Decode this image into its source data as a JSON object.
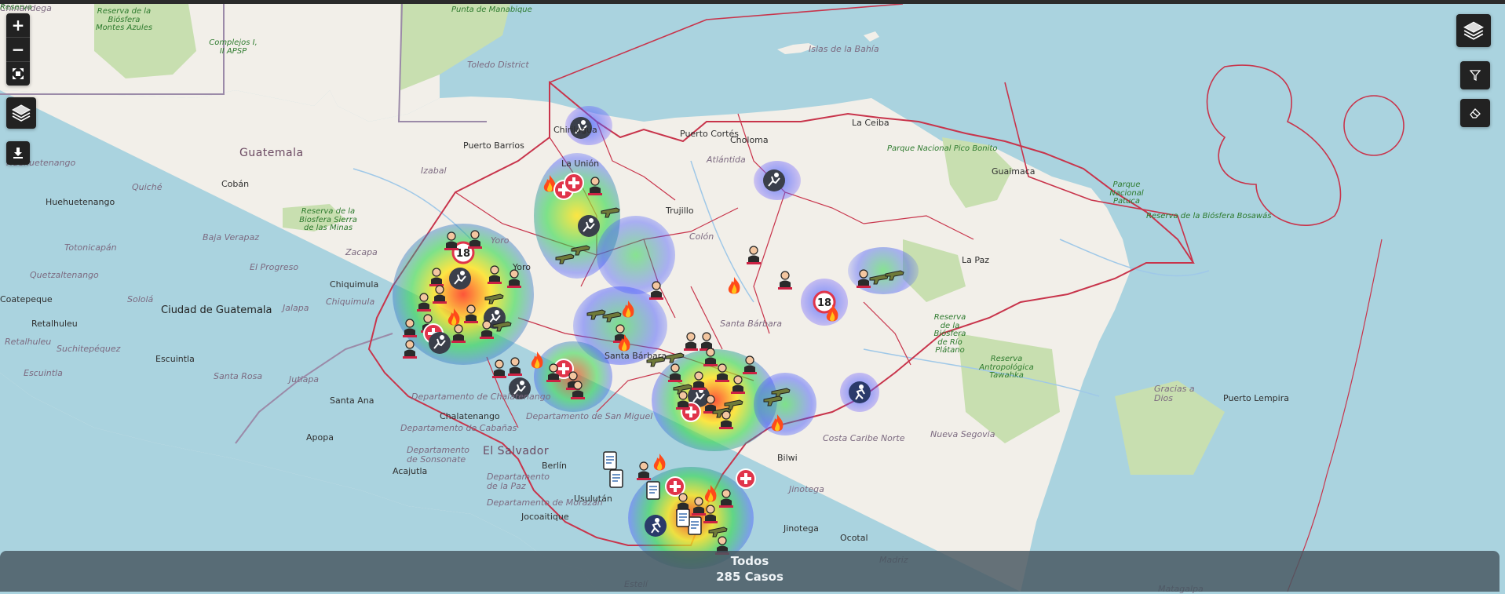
{
  "map": {
    "labels": [
      {
        "text": "Reserva de la Biósfera Montes Azules",
        "cls": "lbl-park"
      },
      {
        "text": "Complejos I, II APSP",
        "cls": "lbl-park"
      },
      {
        "text": "Punta de Manabique",
        "cls": "lbl-park"
      },
      {
        "text": "Toledo District",
        "cls": "lbl-dept"
      },
      {
        "text": "Islas de la Bahía",
        "cls": "lbl-dept"
      },
      {
        "text": "Guatemala",
        "cls": "lbl-country"
      },
      {
        "text": "Huehuetenango",
        "cls": "lbl-dept"
      },
      {
        "text": "Huehuetenango",
        "cls": "lbl-city"
      },
      {
        "text": "Cobán",
        "cls": "lbl-city"
      },
      {
        "text": "Quiché",
        "cls": "lbl-dept"
      },
      {
        "text": "Izabal",
        "cls": "lbl-dept"
      },
      {
        "text": "Puerto Barrios",
        "cls": "lbl-city"
      },
      {
        "text": "Reserva de la Biosfera Sierra de las Minas",
        "cls": "lbl-park"
      },
      {
        "text": "Baja Verapaz",
        "cls": "lbl-dept"
      },
      {
        "text": "Totonicapán",
        "cls": "lbl-dept"
      },
      {
        "text": "El Progreso",
        "cls": "lbl-dept"
      },
      {
        "text": "Zacapa",
        "cls": "lbl-dept"
      },
      {
        "text": "Quetzaltenango",
        "cls": "lbl-dept"
      },
      {
        "text": "Chiquimula",
        "cls": "lbl-city"
      },
      {
        "text": "Chiquimula",
        "cls": "lbl-dept"
      },
      {
        "text": "Coatepeque",
        "cls": "lbl-city"
      },
      {
        "text": "Sololá",
        "cls": "lbl-dept"
      },
      {
        "text": "Ciudad de Guatemala",
        "cls": "lbl-cap"
      },
      {
        "text": "Jalapa",
        "cls": "lbl-dept"
      },
      {
        "text": "Retalhuleu",
        "cls": "lbl-city"
      },
      {
        "text": "Retalhuleu",
        "cls": "lbl-dept"
      },
      {
        "text": "Suchitepéquez",
        "cls": "lbl-dept"
      },
      {
        "text": "Escuintla",
        "cls": "lbl-city"
      },
      {
        "text": "Escuintla",
        "cls": "lbl-dept"
      },
      {
        "text": "Santa Rosa",
        "cls": "lbl-dept"
      },
      {
        "text": "Jutiapa",
        "cls": "lbl-dept"
      },
      {
        "text": "Santa Ana",
        "cls": "lbl-city"
      },
      {
        "text": "Departamento de Chalatenango",
        "cls": "lbl-dept"
      },
      {
        "text": "Chalatenango",
        "cls": "lbl-city"
      },
      {
        "text": "Departamento de Cabañas",
        "cls": "lbl-dept"
      },
      {
        "text": "Apopa",
        "cls": "lbl-city"
      },
      {
        "text": "Departamento de Sonsonate",
        "cls": "lbl-dept"
      },
      {
        "text": "El Salvador",
        "cls": "lbl-country"
      },
      {
        "text": "Acajutla",
        "cls": "lbl-city"
      },
      {
        "text": "Departamento de la Paz",
        "cls": "lbl-dept"
      },
      {
        "text": "Berlín",
        "cls": "lbl-city"
      },
      {
        "text": "Departamento de San Miguel",
        "cls": "lbl-dept"
      },
      {
        "text": "Departamento de Morazán",
        "cls": "lbl-dept"
      },
      {
        "text": "Jocoaitique",
        "cls": "lbl-city"
      },
      {
        "text": "Usulután",
        "cls": "lbl-city"
      },
      {
        "text": "Chirilagua",
        "cls": "lbl-city"
      },
      {
        "text": "La Unión",
        "cls": "lbl-city"
      },
      {
        "text": "Puerto Cortés",
        "cls": "lbl-city"
      },
      {
        "text": "Choloma",
        "cls": "lbl-city"
      },
      {
        "text": "Atlántida",
        "cls": "lbl-dept"
      },
      {
        "text": "La Ceiba",
        "cls": "lbl-city"
      },
      {
        "text": "Parque Nacional Pico Bonito",
        "cls": "lbl-park"
      },
      {
        "text": "Trujillo",
        "cls": "lbl-city"
      },
      {
        "text": "Colón",
        "cls": "lbl-dept"
      },
      {
        "text": "Yoro",
        "cls": "lbl-dept"
      },
      {
        "text": "Yoro",
        "cls": "lbl-city"
      },
      {
        "text": "Santa Bárbara",
        "cls": "lbl-dept"
      },
      {
        "text": "Santa Bárbara",
        "cls": "lbl-city"
      },
      {
        "text": "Guaimaca",
        "cls": "lbl-city"
      },
      {
        "text": "La Paz",
        "cls": "lbl-city"
      },
      {
        "text": "Reserva de la Biósfera de Río Plátano",
        "cls": "lbl-park"
      },
      {
        "text": "Reserva Antropológica Tawahka",
        "cls": "lbl-park"
      },
      {
        "text": "Parque Nacional Patuca",
        "cls": "lbl-park"
      },
      {
        "text": "Reserva de la Biósfera Bosawás",
        "cls": "lbl-park"
      },
      {
        "text": "Gracias a Dios",
        "cls": "lbl-dept"
      },
      {
        "text": "Puerto Lempira",
        "cls": "lbl-city"
      },
      {
        "text": "Costa Caribe Norte",
        "cls": "lbl-dept"
      },
      {
        "text": "Bilwi",
        "cls": "lbl-city"
      },
      {
        "text": "Nueva Segovia",
        "cls": "lbl-dept"
      },
      {
        "text": "Ocotal",
        "cls": "lbl-city"
      },
      {
        "text": "Jinotega",
        "cls": "lbl-dept"
      },
      {
        "text": "Jinotega",
        "cls": "lbl-city"
      },
      {
        "text": "Madriz",
        "cls": "lbl-dept"
      },
      {
        "text": "Estelí",
        "cls": "lbl-dept"
      },
      {
        "text": "Matagalpa",
        "cls": "lbl-dept"
      },
      {
        "text": "Chinandega",
        "cls": "lbl-dept"
      },
      {
        "text": "Reserva",
        "cls": "lbl-park"
      }
    ],
    "colors": {
      "water": "#aad3df",
      "land": "#f2efe9",
      "park": "#c8dfb0",
      "honduras_border": "#c8344b",
      "country_border": "#9b8aa8",
      "control_bg": "#222222"
    }
  },
  "controls": {
    "zoom_in_label": "+",
    "zoom_out_label": "−",
    "fullscreen_icon": "fullscreen-icon",
    "layers_icon": "layers-icon",
    "download_icon": "download-icon",
    "filter_icon": "filter-icon",
    "eraser_icon": "eraser-icon"
  },
  "footer": {
    "title": "Todos",
    "count": "285 Casos"
  }
}
